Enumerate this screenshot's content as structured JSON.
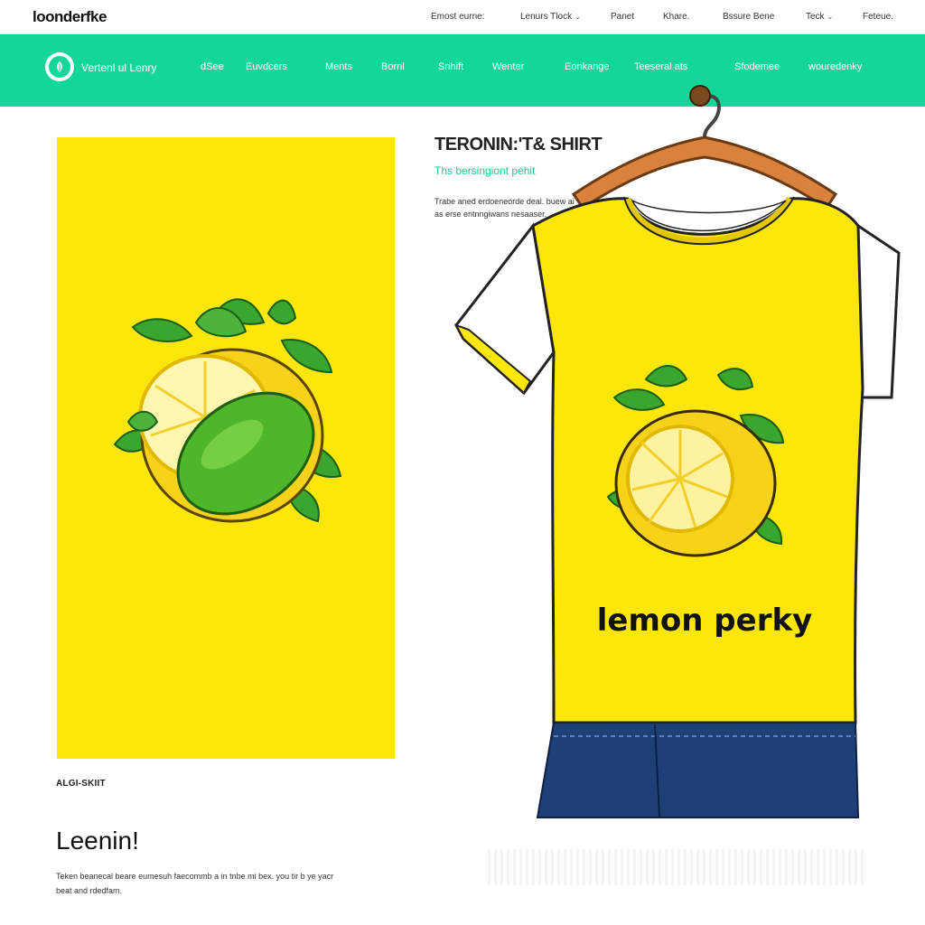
{
  "topbar": {
    "logo": "loonderfke",
    "items": [
      {
        "label": "Emost eurne:",
        "has_chevron": false
      },
      {
        "label": "Lenurs Tlock",
        "has_chevron": true
      },
      {
        "label": "Panet",
        "has_chevron": false
      },
      {
        "label": "Khare.",
        "has_chevron": false
      },
      {
        "label": "Bssure Bene",
        "has_chevron": false
      },
      {
        "label": "Teck",
        "has_chevron": true
      },
      {
        "label": "Feteue.",
        "has_chevron": false
      }
    ]
  },
  "nav": {
    "brand": "Vertenl ul Lenry",
    "items": [
      "dSee",
      "Euvdcers",
      "Ments",
      "Bornl",
      "Snhift",
      "Wenter",
      "Eonkange",
      "Teeseral ats",
      "Sfodemee",
      "wouredenky"
    ]
  },
  "product": {
    "title": "TERONIN:'T& SHIRT",
    "subtitle": "Ths bersingiont pehit",
    "description": "Trabe aned erdoeneorde deal. buew ai as erse entnngiwans nesaaser.",
    "print_text": "lemon perky"
  },
  "left_panel": {
    "caption": "ALGI-SKIIT"
  },
  "lower": {
    "title": "Leenin!",
    "description": "Teken beanecal beare eumesuh faecommb a in tnbe mi bex. you tir b ye yacr beat and rdedfam."
  },
  "colors": {
    "accent_green": "#13d69a",
    "lemon_yellow": "#fde60a",
    "leaf_green": "#2f9e2a",
    "denim": "#1f3f78"
  }
}
